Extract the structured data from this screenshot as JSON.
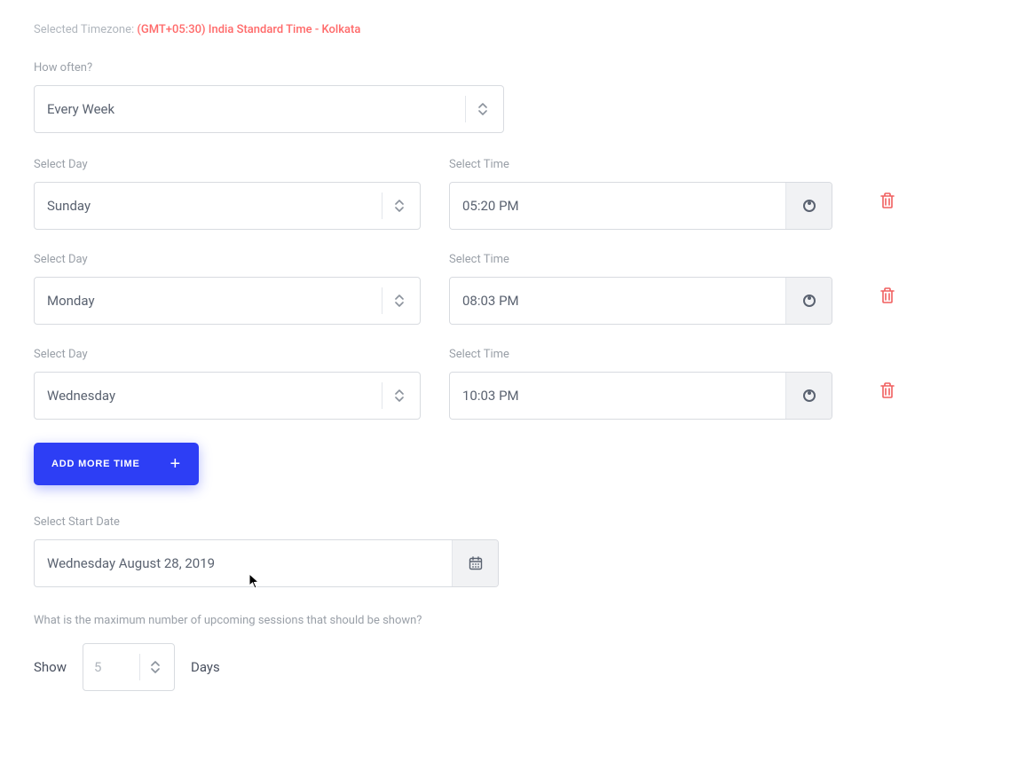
{
  "timezone": {
    "label": "Selected Timezone: ",
    "value": "(GMT+05:30) India Standard Time - Kolkata"
  },
  "how_often": {
    "label": "How often?",
    "value": "Every Week"
  },
  "rows": [
    {
      "day_label": "Select Day",
      "day_value": "Sunday",
      "time_label": "Select Time",
      "time_value": "05:20 PM"
    },
    {
      "day_label": "Select Day",
      "day_value": "Monday",
      "time_label": "Select Time",
      "time_value": "08:03 PM"
    },
    {
      "day_label": "Select Day",
      "day_value": "Wednesday",
      "time_label": "Select Time",
      "time_value": "10:03 PM"
    }
  ],
  "add_more_label": "ADD MORE TIME",
  "start_date": {
    "label": "Select Start Date",
    "value": "Wednesday August 28, 2019"
  },
  "max_sessions": {
    "question": "What is the maximum number of upcoming sessions that should be shown?",
    "show_label": "Show",
    "value": "5",
    "unit": "Days"
  }
}
